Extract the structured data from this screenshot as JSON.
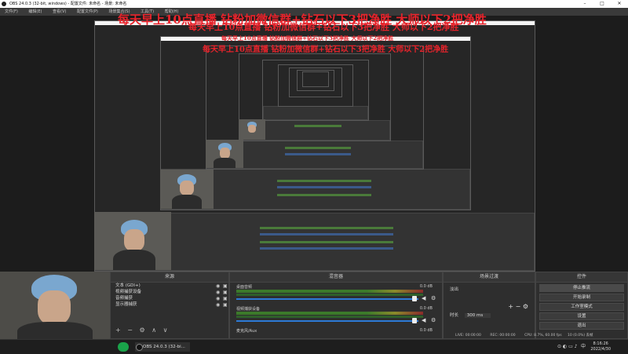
{
  "window": {
    "title": "OBS 24.0.3 (32-bit, windows) - 配置文件: 未命名 - 场景: 未命名",
    "controls": [
      "–",
      "□",
      "✕"
    ]
  },
  "menu": [
    "文件(F)",
    "编辑(E)",
    "查看(V)",
    "配置文件(P)",
    "场景集合(S)",
    "工具(T)",
    "帮助(H)"
  ],
  "overlay": {
    "line1": "每天早上10点直播 钻粉加微信群+钻石以下3把净胜 大师以下2把净胜",
    "line2": "每天早上10点直播 钻粉加微信群+钻石以下3把净胜 大师以下2把净胜",
    "line3": "每天早上10点直播 钻粉加微信群+钻石以下3把净胜 大师以下2把净胜",
    "line4": "每天早上10点直播 钻粉加微信群+钻石以下3把净胜 大师以下2把净胜"
  },
  "sources": {
    "header": "来源",
    "items": [
      "文本 (GDI+)",
      "视频捕获设备",
      "音频捕获",
      "显示器捕获"
    ]
  },
  "mixer": {
    "header": "混音器",
    "tracks": [
      {
        "name": "桌面音频",
        "db": "0.0 dB"
      },
      {
        "name": "视频捕获设备",
        "db": "0.0 dB"
      },
      {
        "name": "麦克风/Aux",
        "db": "0.0 dB"
      }
    ]
  },
  "transitions": {
    "header": "场景过渡",
    "type": "淡出",
    "duration_label": "时长",
    "duration_value": "300 ms"
  },
  "controls": {
    "header": "控件",
    "buttons": [
      "停止推流",
      "开始录制",
      "工作室模式",
      "设置",
      "退出"
    ]
  },
  "status": {
    "live": "LIVE: 00:00:00",
    "rec": "REC: 00:00:00",
    "cpu": "CPU: 8.7%, 60.00 fps",
    "dropped": "10 (0.0%) 丢帧"
  },
  "taskbar": {
    "obs_item": "OBS 24.0.3 (32-bi...",
    "time": "8:16:26",
    "date": "2022/4/30",
    "lang": "中"
  },
  "colors": {
    "overlay_red": "#e8232b",
    "meter_green": "#3c7a2a",
    "slider_blue": "#2d7ad6"
  }
}
